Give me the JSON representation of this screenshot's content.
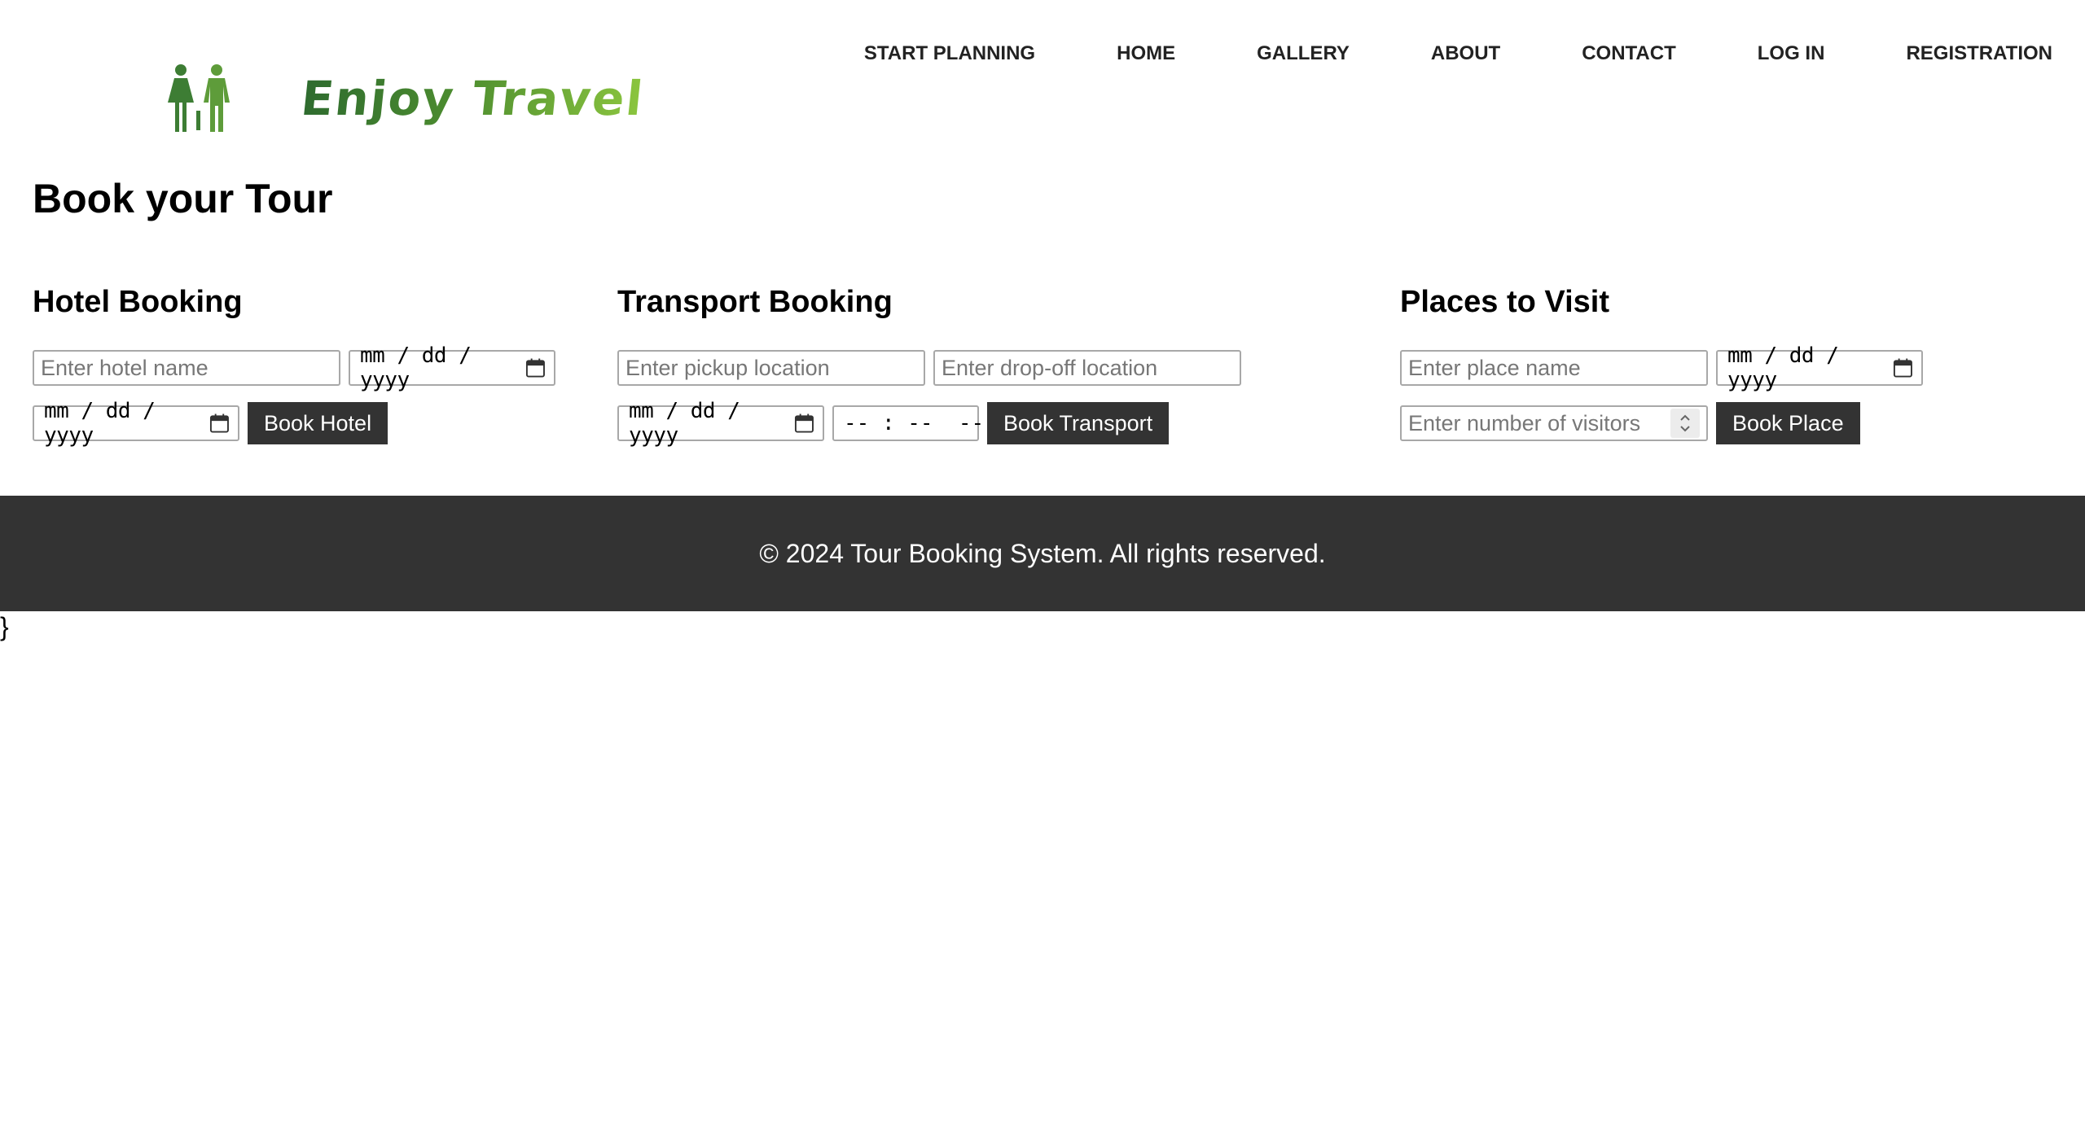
{
  "header": {
    "logo_text": "Enjoy Travel",
    "logo_icon": "couple-figures-icon",
    "nav": [
      {
        "label": "START PLANNING"
      },
      {
        "label": "HOME"
      },
      {
        "label": "GALLERY"
      },
      {
        "label": "ABOUT"
      },
      {
        "label": "CONTACT"
      },
      {
        "label": "LOG IN"
      },
      {
        "label": "REGISTRATION"
      }
    ]
  },
  "page_title": "Book your Tour",
  "hotel": {
    "title": "Hotel Booking",
    "name_placeholder": "Enter hotel name",
    "checkin_date": "mm / dd / yyyy",
    "checkout_date": "mm / dd / yyyy",
    "button": "Book Hotel"
  },
  "transport": {
    "title": "Transport Booking",
    "pickup_placeholder": "Enter pickup location",
    "dropoff_placeholder": "Enter drop-off location",
    "date": "mm / dd / yyyy",
    "time": "-- : --  --",
    "button": "Book Transport"
  },
  "places": {
    "title": "Places to Visit",
    "place_placeholder": "Enter place name",
    "date": "mm / dd / yyyy",
    "visitors_placeholder": "Enter number of visitors",
    "button": "Book Place"
  },
  "footer": {
    "text": "© 2024 Tour Booking System. All rights reserved."
  },
  "stray_text": "}",
  "colors": {
    "button_bg": "#333333",
    "footer_bg": "#333333",
    "logo_green_dark": "#2e6b2f",
    "logo_green_light": "#8cc63f"
  }
}
